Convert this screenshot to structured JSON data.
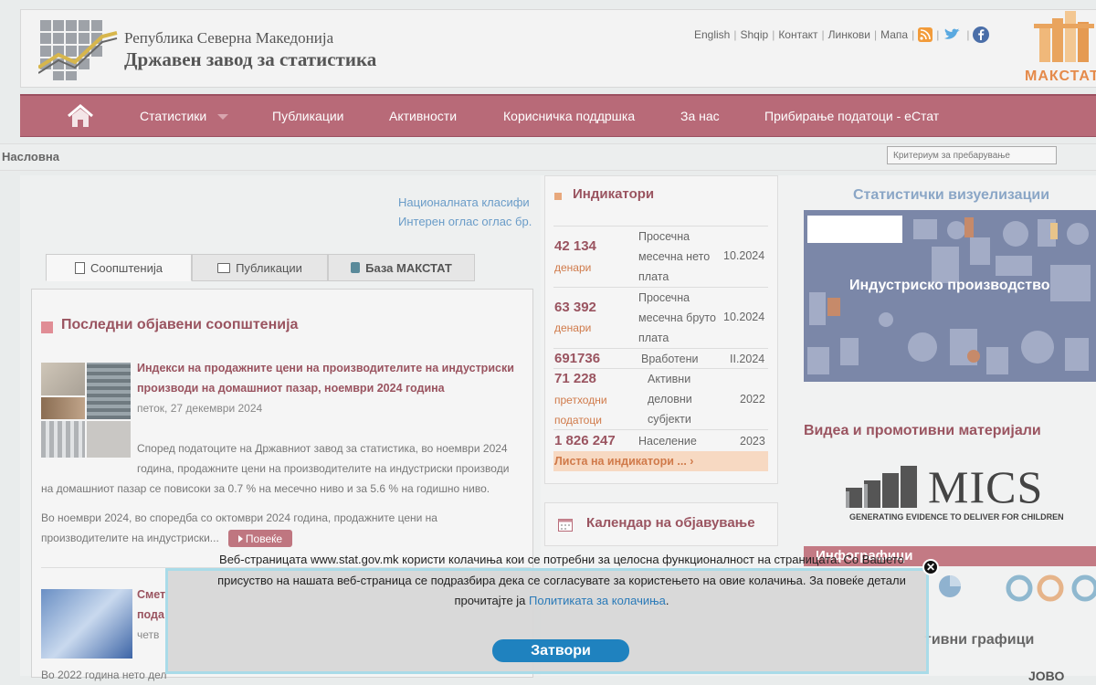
{
  "header": {
    "republic": "Република Северна Македонија",
    "institution": "Државен завод за статистика",
    "links": [
      "English",
      "Shqip",
      "Контакт",
      "Линкови",
      "Мапа"
    ],
    "makstat_logo": "МАКСТАТ"
  },
  "nav": {
    "items": [
      "Статистики",
      "Публикации",
      "Активности",
      "Корисничка поддршка",
      "За нас",
      "Прибирање податоци - еСтат"
    ]
  },
  "breadcrumb": "Насловна",
  "search": {
    "placeholder": "Критериум за пребарување"
  },
  "marquee": [
    "Националната класифи",
    "Интерен оглас оглас бр."
  ],
  "tabs": [
    "Соопштенија",
    "Публикации",
    "База МАКСТАТ"
  ],
  "latest": {
    "title": "Последни објавени соопштенија",
    "item1": {
      "title_line1": "Индекси на продажните цени на производителите на индустриски",
      "title_line2": "производи на домашниот пазар, ноември 2024 година",
      "date": "петок, 27 декември 2024",
      "text_line1": "Според податоците на Државниот завод за статистика, во ноември 2024",
      "text_line2": "година, продажните цени на производителите на индустриски производи",
      "text_line3": "на домашниот пазар се повисоки за 0.7 % на месечно ниво и за 5.6 % на годишно ниво.",
      "text_line4": "Во ноември 2024, во споредба со октомври 2024 година, продажните цени на",
      "text_line5": "производителите на индустриски...",
      "more": "Повеќе"
    },
    "item2": {
      "title_line1": "Смет",
      "title_line2": "пода",
      "date": "четв",
      "text": "Во 2022 година нето дел"
    }
  },
  "indicators": {
    "title": "Индикатори",
    "rows": [
      {
        "value": "42 134",
        "unit": "денари",
        "label": [
          "Просечна",
          "месечна нето",
          "плата"
        ],
        "date": "10.2024"
      },
      {
        "value": "63 392",
        "unit": "денари",
        "label": [
          "Просечна",
          "месечна бруто",
          "плата"
        ],
        "date": "10.2024"
      },
      {
        "value": "691736",
        "unit": "",
        "label": [
          "Вработени"
        ],
        "date": "II.2024"
      },
      {
        "value": "71 228",
        "unit": "претходни податоци",
        "label": [
          "Активни",
          "деловни",
          "субјекти"
        ],
        "date": "2022"
      },
      {
        "value": "1 826 247",
        "unit": "",
        "label": [
          "Население"
        ],
        "date": "2023"
      }
    ],
    "unit_line1": "претходни",
    "unit_line2": "податоци",
    "list_link": "Листа на индикатори ..."
  },
  "calendar": {
    "title": "Календар на објавување"
  },
  "right": {
    "viz_title": "Статистички визуелизации",
    "viz_caption": "Индустриско производство",
    "video_title": "Видеа и промотивни материјали",
    "mics_name": "MICS",
    "mics_tagline": "GENERATING EVIDENCE TO DELIVER FOR CHILDREN",
    "info_title": "Инфографици",
    "graphs_title": "тивни графици",
    "bottom": "ЈОВО"
  },
  "cookie": {
    "text1": "Веб-страницата www.stat.gov.mk користи колачиња кои се потребни за целосна функционалност на страницата. Со Вашето",
    "text2": "присуство на нашата веб-страница се подразбира дека се согласувате за користењето на овие колачиња. За повеќе детали",
    "text3": "прочитајте ја",
    "link": "Политиката за колачиња",
    "close": "Затвори"
  },
  "colors": {
    "brand": "#b86a78",
    "accent_title": "#9a5460",
    "link": "#2a7ab8",
    "button": "#1f82bf"
  }
}
